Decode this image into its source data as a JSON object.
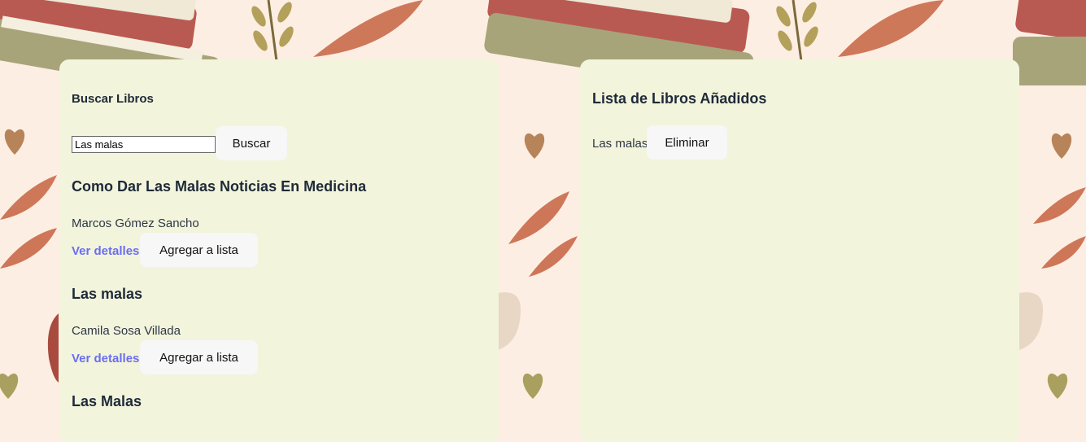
{
  "search": {
    "heading": "Buscar Libros",
    "input_value": "Las malas",
    "button_label": "Buscar"
  },
  "results": [
    {
      "title": "Como Dar Las Malas Noticias En Medicina",
      "author": "Marcos Gómez Sancho",
      "details_label": "Ver detalles",
      "add_label": "Agregar a lista"
    },
    {
      "title": "Las malas",
      "author": "Camila Sosa Villada",
      "details_label": "Ver detalles",
      "add_label": "Agregar a lista"
    },
    {
      "title": "Las Malas"
    }
  ],
  "list": {
    "heading": "Lista de Libros Añadidos",
    "items": [
      {
        "title": "Las malas",
        "remove_label": "Eliminar"
      }
    ]
  },
  "colors": {
    "background": "#fdeee3",
    "panel": "#f3f4dc",
    "link": "#6a6ef0",
    "heading": "#1e2a38"
  }
}
